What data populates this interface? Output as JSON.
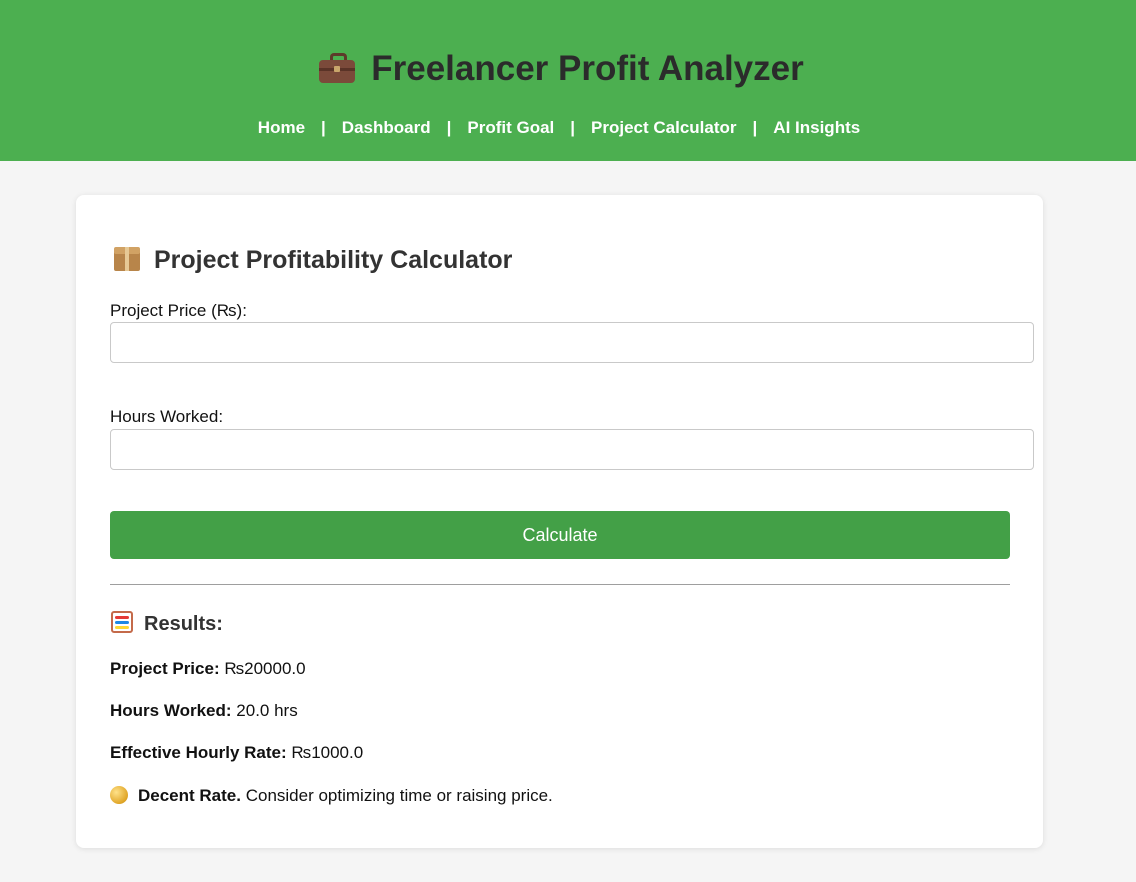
{
  "header": {
    "title": "Freelancer Profit Analyzer",
    "title_icon": "briefcase-icon",
    "nav": [
      {
        "label": "Home"
      },
      {
        "label": "Dashboard"
      },
      {
        "label": "Profit Goal"
      },
      {
        "label": "Project Calculator"
      },
      {
        "label": "AI Insights"
      }
    ],
    "nav_separator": "|",
    "background_color": "#4caf50"
  },
  "calculator": {
    "title": "Project Profitability Calculator",
    "title_icon": "package-icon",
    "fields": [
      {
        "label": "Project Price (₨):",
        "value": ""
      },
      {
        "label": "Hours Worked:",
        "value": ""
      }
    ],
    "button_label": "Calculate",
    "button_color": "#43a047"
  },
  "results": {
    "title": "Results:",
    "title_icon": "abacus-icon",
    "lines": [
      {
        "label": "Project Price:",
        "value": "₨20000.0"
      },
      {
        "label": "Hours Worked:",
        "value": "20.0 hrs"
      },
      {
        "label": "Effective Hourly Rate:",
        "value": "₨1000.0"
      }
    ],
    "verdict": {
      "icon": "yellow-circle-icon",
      "label": "Decent Rate.",
      "text": "Consider optimizing time or raising price."
    }
  }
}
